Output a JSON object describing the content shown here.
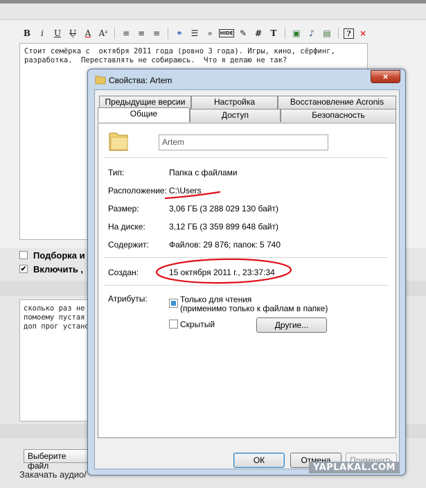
{
  "toolbar": {
    "buttons": [
      "B",
      "i",
      "U",
      "Ụ",
      "A",
      "Aᶻ",
      "≡",
      "≡",
      "≡",
      "⚭",
      "☰",
      "»",
      "HIDE",
      "✎",
      "#",
      "T",
      "▣",
      "♪",
      "▤",
      "?",
      "×"
    ]
  },
  "editor1": {
    "text": "Стоит семёрка с  октября 2011 года (ровно 3 года). Игры, кино, сёрфинг,\nразработка.  Переставлять не собираюсь.  Что я делаю не так?"
  },
  "options": {
    "opt1_label": "Подборка и",
    "opt2_label": "Включить ,",
    "opt2_check": "✔"
  },
  "editor2": {
    "text": "сколько раз не\nпомоему пустая\nдоп прог устано"
  },
  "page": {
    "file_button": "Выберите файл",
    "audio_link": "Закачать аудио/",
    "watermark": "YAPLAKAL.COM"
  },
  "dialog": {
    "title": "Свойства: Artem",
    "close": "×",
    "tabs_row1": [
      "Предыдущие версии",
      "Настройка",
      "Восстановление Acronis"
    ],
    "tabs_row2": [
      "Общие",
      "Доступ",
      "Безопасность"
    ],
    "name_value": "Artem",
    "type_label": "Тип:",
    "type_value": "Папка с файлами",
    "location_label": "Расположение:",
    "location_value": "C:\\Users",
    "size_label": "Размер:",
    "size_value": "3,06 ГБ (3 288 029 130 байт)",
    "disk_label": "На диске:",
    "disk_value": "3,12 ГБ (3 359 899 648 байт)",
    "contains_label": "Содержит:",
    "contains_value": "Файлов: 29 876; папок: 5 740",
    "created_label": "Создан:",
    "created_value": "15 октября 2011 г., 23:37:34",
    "attributes_label": "Атрибуты:",
    "readonly_label": "Только для чтения",
    "readonly_note": "(применимо только к файлам в папке)",
    "hidden_label": "Скрытый",
    "other_button": "Другие...",
    "ok_button": "ОК",
    "cancel_button": "Отмена",
    "apply_button": "Применить"
  },
  "colors": {
    "dialog_frame": "#c7d9ea",
    "annotation_red": "#e0101a",
    "checkbox_indeterminate": "#3c8fcf"
  }
}
